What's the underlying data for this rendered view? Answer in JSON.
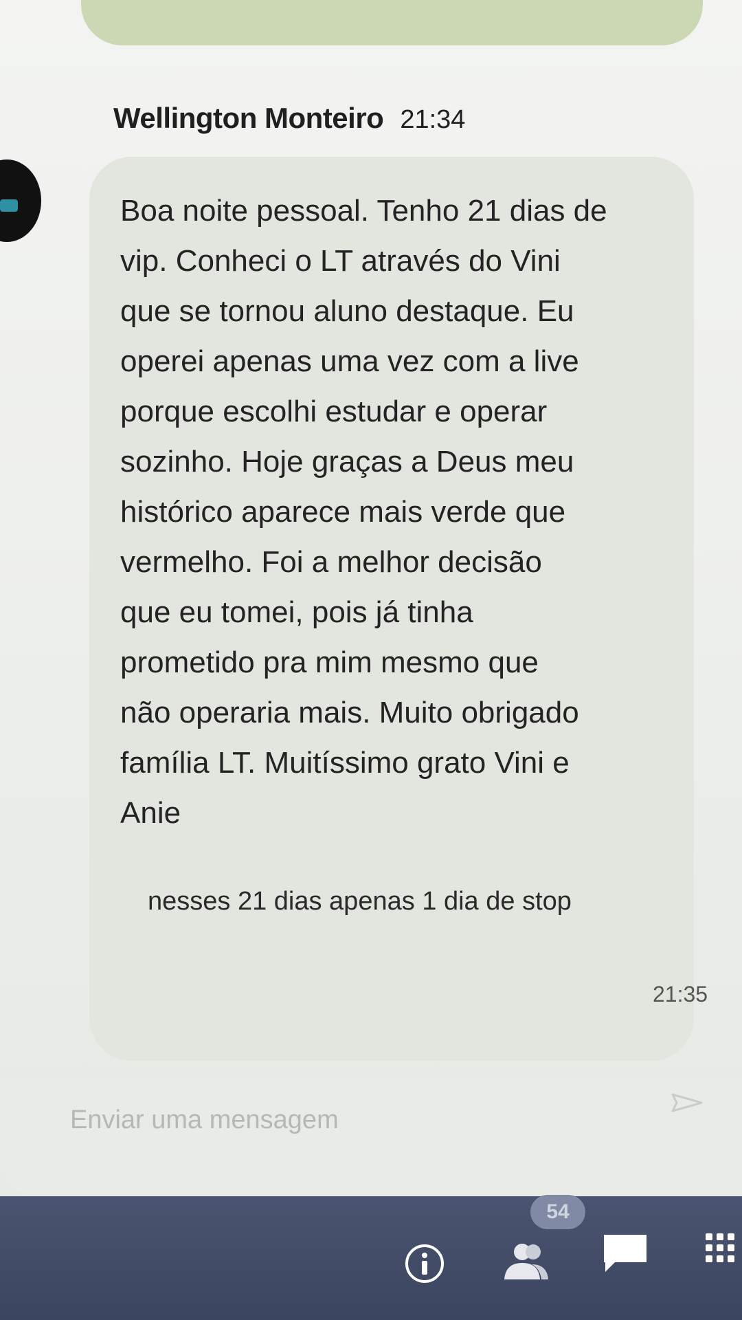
{
  "message": {
    "sender": "Wellington Monteiro",
    "time": "21:34",
    "text": "Boa noite pessoal. Tenho 21 dias de\nvip. Conheci o LT através do Vini\nque se tornou aluno destaque. Eu\noperei apenas uma vez com a live\nporque escolhi estudar e operar\nsozinho. Hoje graças a Deus meu\nhistórico aparece mais verde que\nvermelho. Foi a melhor decisão\nque eu tomei, pois já tinha\nprometido pra mim mesmo que\nnão operaria mais. Muito obrigado\nfamília LT. Muitíssimo grato Vini e\nAnie"
  },
  "followup": {
    "text": "nesses 21 dias apenas 1 dia de stop",
    "time": "21:35"
  },
  "composer": {
    "placeholder": "Enviar uma mensagem",
    "send_icon": "send-icon"
  },
  "bottom_nav": {
    "badge": "54",
    "icons": [
      "info-icon",
      "people-icon",
      "chat-icon",
      "apps-grid-icon"
    ]
  },
  "colors": {
    "prev_bubble": "#ccd8b4",
    "bubble": "#e2e6df",
    "bottom_bar": "#3c455f"
  }
}
